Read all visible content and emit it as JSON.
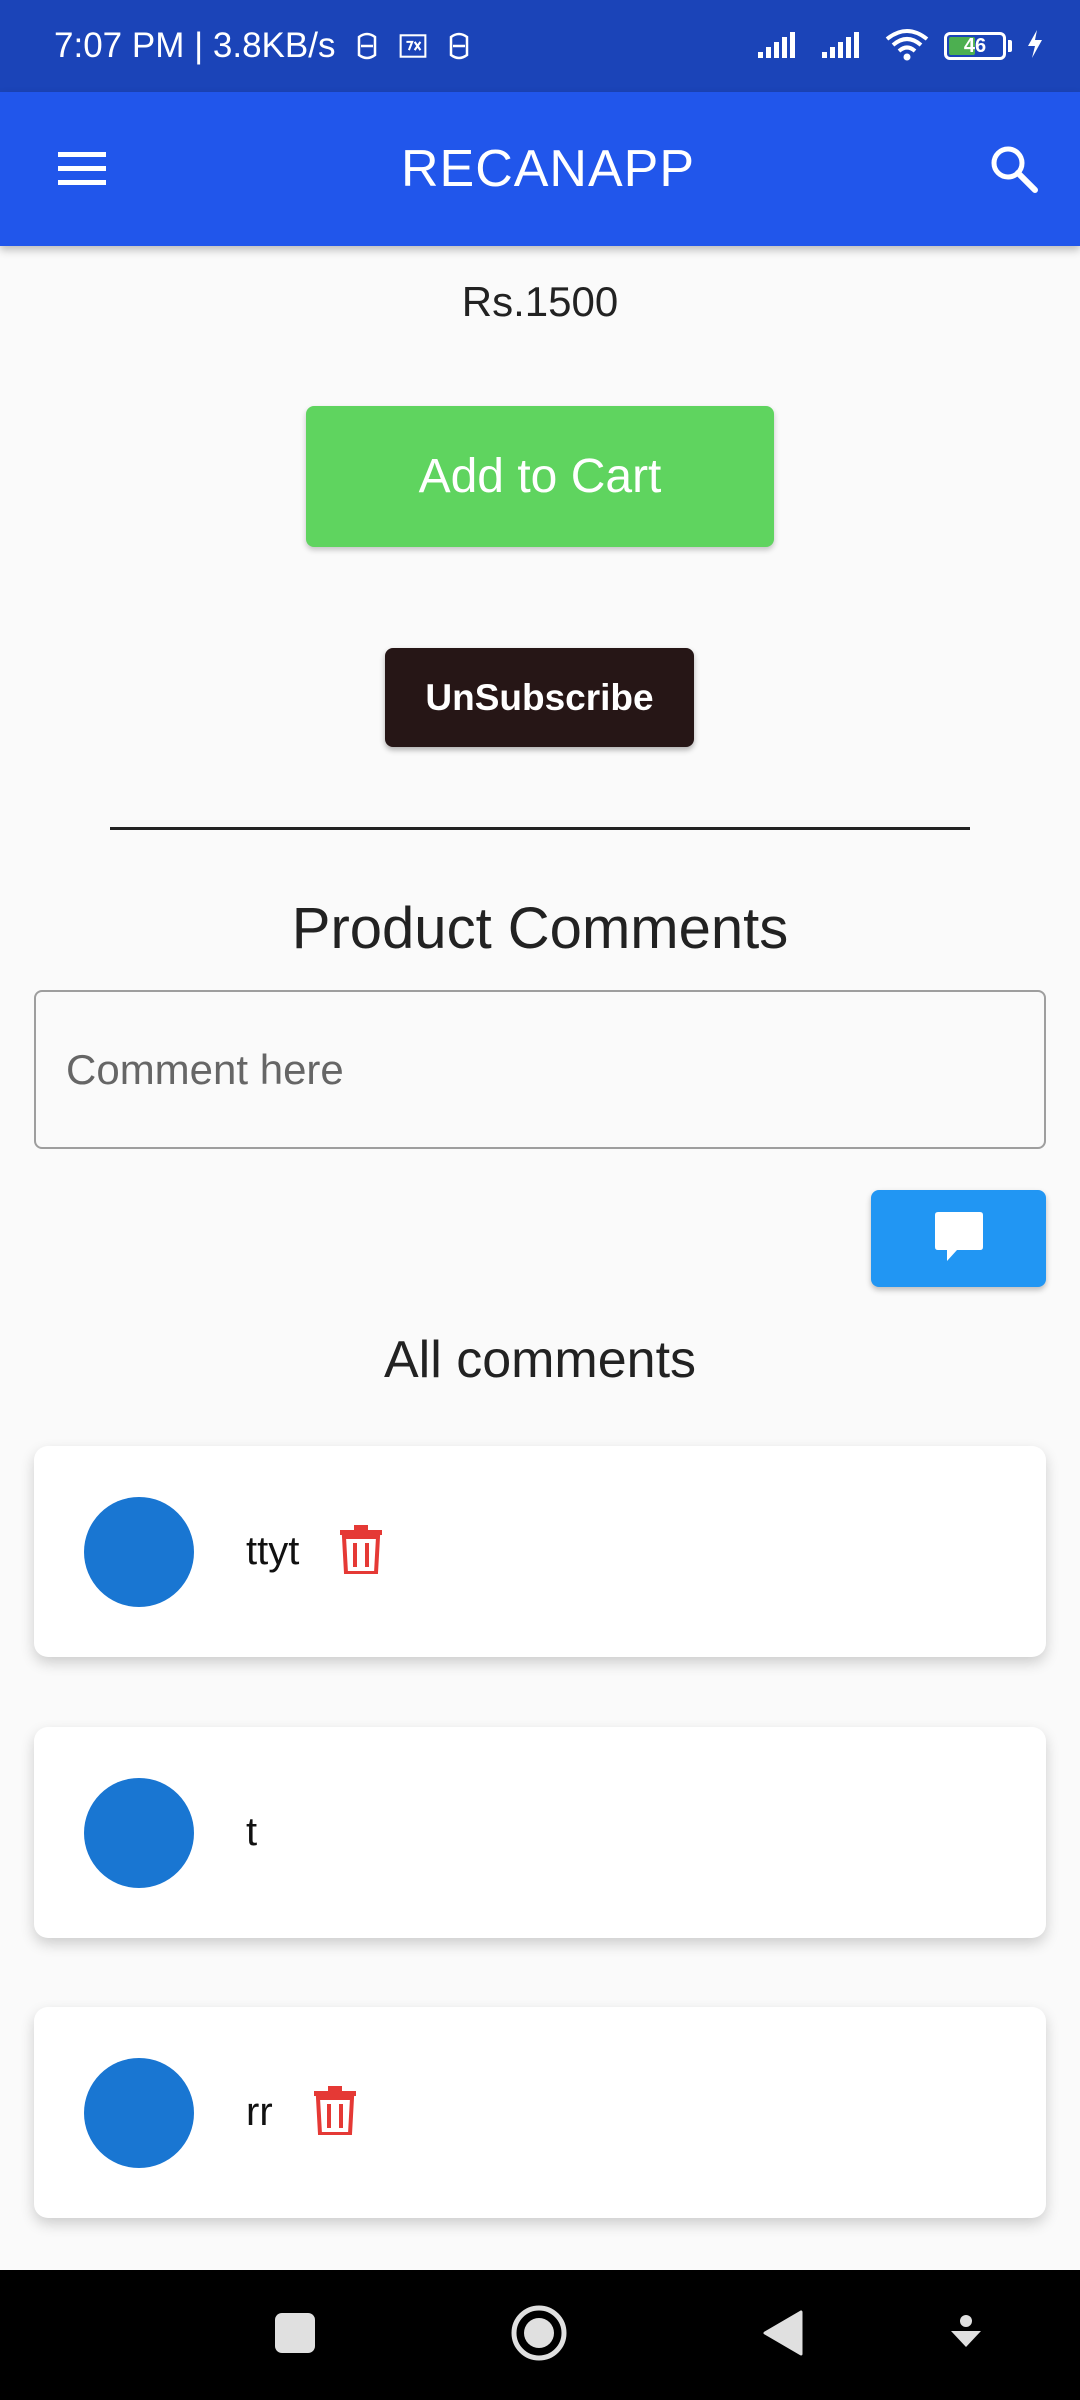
{
  "status_bar": {
    "time_speed": "7:07 PM | 3.8KB/s",
    "battery_level": "46"
  },
  "app_bar": {
    "title": "RECANAPP"
  },
  "product": {
    "price": "Rs.1500",
    "add_to_cart_label": "Add to Cart",
    "unsubscribe_label": "UnSubscribe"
  },
  "comments_section": {
    "title": "Product Comments",
    "input_placeholder": "Comment here",
    "input_value": "",
    "all_comments_label": "All comments",
    "items": [
      {
        "text": "ttyt",
        "deletable": true
      },
      {
        "text": "t",
        "deletable": false
      },
      {
        "text": "rr",
        "deletable": true
      }
    ]
  },
  "colors": {
    "status_bar": "#1b44b8",
    "app_bar": "#2156eb",
    "add_to_cart": "#5fd45f",
    "unsubscribe": "#261616",
    "send_button": "#2196f3",
    "avatar": "#1976d2",
    "delete_icon": "#e53935"
  },
  "icons": {
    "menu": "menu-icon",
    "search": "search-icon",
    "send": "comment-icon",
    "delete": "trash-icon"
  }
}
